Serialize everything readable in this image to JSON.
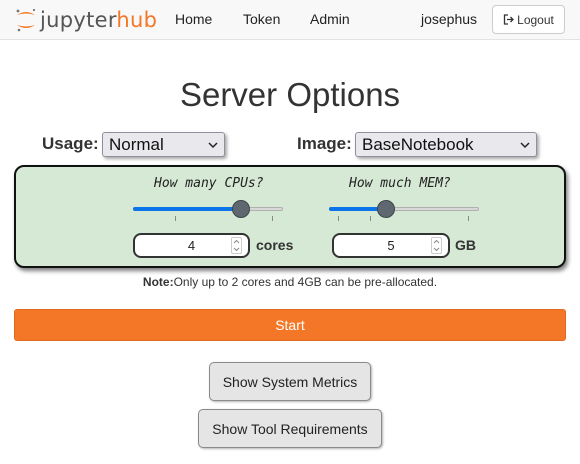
{
  "navbar": {
    "logo_text_part1": "jupyter",
    "logo_text_part2": "hub",
    "links": [
      "Home",
      "Token",
      "Admin"
    ],
    "user": "josephus",
    "logout_label": "Logout",
    "logout_icon": "sign-out-icon"
  },
  "page_title": "Server Options",
  "usage": {
    "label": "Usage:",
    "selected": "Normal"
  },
  "image": {
    "label": "Image:",
    "selected": "BaseNotebook"
  },
  "cpu": {
    "question": "How many CPUs?",
    "value": "4",
    "unit": "cores",
    "slider_fraction": 0.72
  },
  "mem": {
    "question": "How much MEM?",
    "value": "5",
    "unit": "GB",
    "slider_fraction": 0.38
  },
  "note": {
    "bold": "Note:",
    "text": "Only up to 2 cores and 4GB can be pre-allocated."
  },
  "start_label": "Start",
  "buttons": {
    "metrics": "Show System Metrics",
    "tools": "Show Tool Requirements"
  },
  "colors": {
    "accent": "#f37726",
    "panel_bg": "#d5e9d4",
    "slider_fill": "#0a74e8"
  }
}
